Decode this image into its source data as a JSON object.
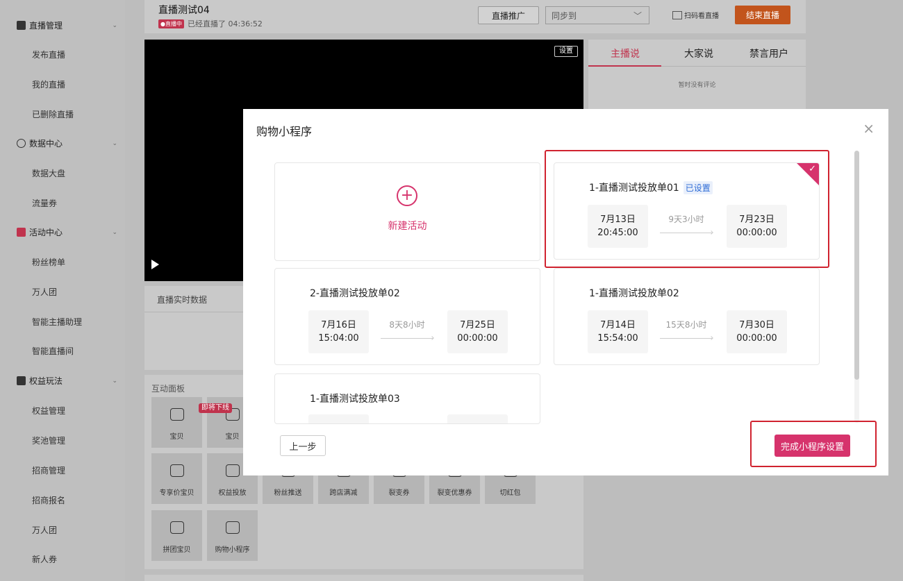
{
  "sidebar": {
    "groups": [
      {
        "label": "直播管理",
        "icon": "monitor-icon",
        "items": [
          "发布直播",
          "我的直播",
          "已删除直播"
        ]
      },
      {
        "label": "数据中心",
        "icon": "chart-circle-icon",
        "items": [
          "数据大盘",
          "流量券"
        ]
      },
      {
        "label": "活动中心",
        "icon": "flag-icon",
        "items": [
          "粉丝榜单",
          "万人团",
          "智能主播助理",
          "智能直播间"
        ]
      },
      {
        "label": "权益玩法",
        "icon": "gift-icon",
        "items": [
          "权益管理",
          "奖池管理",
          "招商管理",
          "招商报名",
          "万人团",
          "新人券"
        ]
      }
    ]
  },
  "header": {
    "title": "直播测试04",
    "badge": "●直播中",
    "elapsed": "已经直播了 04:36:52",
    "promo_label": "直播推广",
    "sync_placeholder": "同步到",
    "scan_label": "扫码看直播",
    "end_label": "结束直播"
  },
  "video": {
    "settings_label": "设置"
  },
  "realtime": {
    "label": "直播实时数据"
  },
  "interact": {
    "label": "互动面板",
    "soon_tag": "即将下线",
    "tiles": [
      "宝贝",
      "宝贝",
      "专享价宝贝",
      "权益投放",
      "粉丝推送",
      "跨店满减",
      "裂变券",
      "裂变优惠券",
      "切红包",
      "拼团宝贝",
      "购物小程序"
    ]
  },
  "comments": {
    "tabs": [
      "主播说",
      "大家说",
      "禁言用户"
    ],
    "empty": "暂时没有评论"
  },
  "modal": {
    "title": "购物小程序",
    "close": "×",
    "new_activity": "新建活动",
    "cards": [
      {
        "title": "1-直播测试投放单01",
        "badge": "已设置",
        "start_date": "7月13日",
        "start_time": "20:45:00",
        "duration": "9天3小时",
        "end_date": "7月23日",
        "end_time": "00:00:00",
        "selected": true
      },
      {
        "title": "2-直播测试投放单02",
        "start_date": "7月16日",
        "start_time": "15:04:00",
        "duration": "8天8小时",
        "end_date": "7月25日",
        "end_time": "00:00:00"
      },
      {
        "title": "1-直播测试投放单02",
        "start_date": "7月14日",
        "start_time": "15:54:00",
        "duration": "15天8小时",
        "end_date": "7月30日",
        "end_time": "00:00:00"
      },
      {
        "title": "1-直播测试投放单03"
      }
    ],
    "prev_label": "上一步",
    "done_label": "完成小程序设置"
  },
  "colors": {
    "accent": "#d6336c",
    "end_button": "#c2541c",
    "highlight": "#d0222f",
    "badge_blue": "#2d6bd6"
  }
}
